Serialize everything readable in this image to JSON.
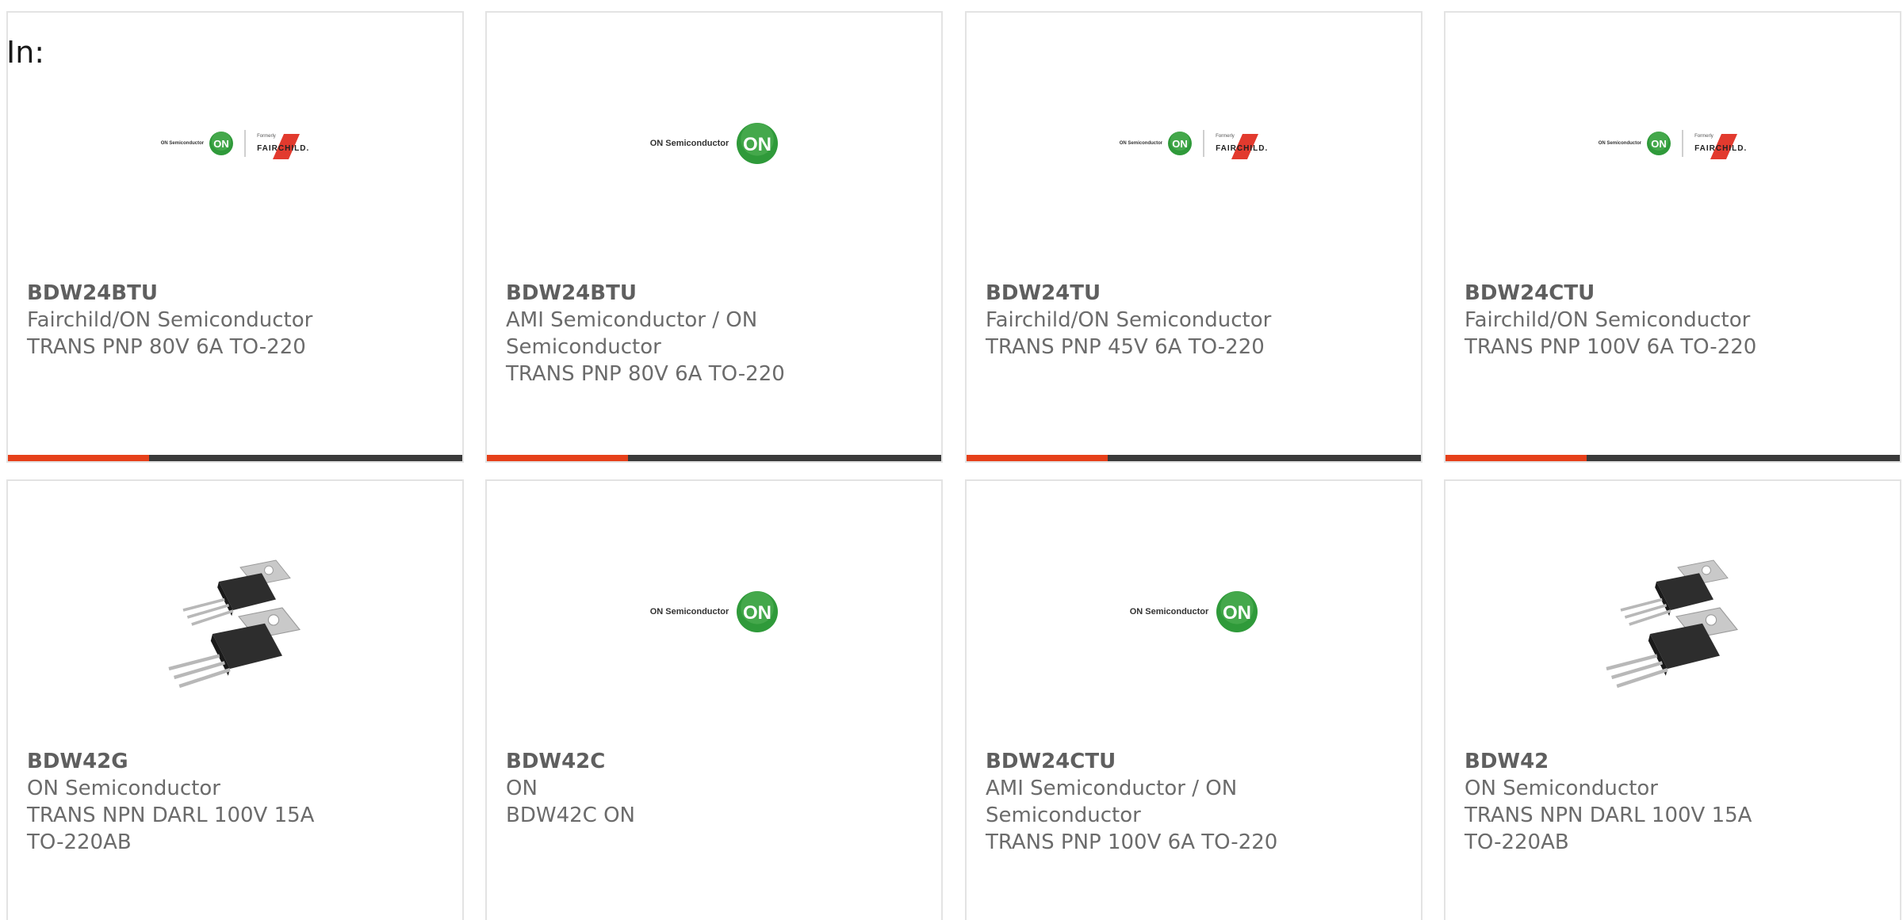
{
  "header": {
    "in_label": "In:"
  },
  "colors": {
    "accent": "#e6401a",
    "bar": "#3a3a3a",
    "border": "#e3e3e3",
    "on_green": "#2f9a3a",
    "fairchild_red": "#e23a2e"
  },
  "logos": {
    "on_text": "ON Semiconductor",
    "on_badge": "ON",
    "fairchild_formerly": "Formerly",
    "fairchild_name": "FAIRCHILD."
  },
  "cards": [
    {
      "part": "BDW24BTU",
      "maker": "Fairchild/ON Semiconductor",
      "desc": "TRANS PNP 80V 6A TO-220",
      "image": "on-fairchild-logo",
      "progress": 0.31
    },
    {
      "part": "BDW24BTU",
      "maker": "AMI Semiconductor / ON Semiconductor",
      "desc": "TRANS PNP 80V 6A TO-220",
      "image": "on-semiconductor-logo",
      "progress": 0.31
    },
    {
      "part": "BDW24TU",
      "maker": "Fairchild/ON Semiconductor",
      "desc": "TRANS PNP 45V 6A TO-220",
      "image": "on-fairchild-logo",
      "progress": 0.31
    },
    {
      "part": "BDW24CTU",
      "maker": "Fairchild/ON Semiconductor",
      "desc": "TRANS PNP 100V 6A TO-220",
      "image": "on-fairchild-logo",
      "progress": 0.31
    },
    {
      "part": "BDW42G",
      "maker": "ON Semiconductor",
      "desc": "TRANS NPN DARL 100V 15A TO-220AB",
      "image": "to220-transistor-photo",
      "progress": null
    },
    {
      "part": "BDW42C",
      "maker": "ON",
      "desc": "BDW42C ON",
      "image": "on-semiconductor-logo",
      "progress": null
    },
    {
      "part": "BDW24CTU",
      "maker": "AMI Semiconductor / ON Semiconductor",
      "desc": "TRANS PNP 100V 6A TO-220",
      "image": "on-semiconductor-logo",
      "progress": null
    },
    {
      "part": "BDW42",
      "maker": "ON Semiconductor",
      "desc": "TRANS NPN DARL 100V 15A TO-220AB",
      "image": "to220-transistor-photo",
      "progress": null
    }
  ]
}
